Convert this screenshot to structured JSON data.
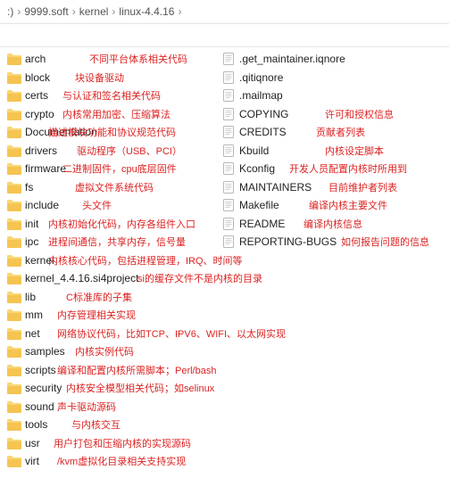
{
  "breadcrumb": {
    "root": ":)",
    "p1": "9999.soft",
    "p2": "kernel",
    "p3": "linux-4.4.16",
    "sep": "›"
  },
  "left": [
    {
      "name": "arch",
      "type": "folder",
      "note": "不同平台体系相关代码",
      "nx": 86
    },
    {
      "name": "block",
      "type": "folder",
      "note": "块设备驱动",
      "nx": 70
    },
    {
      "name": "certs",
      "type": "folder",
      "note": "与认证和签名相关代码",
      "nx": 56
    },
    {
      "name": "crypto",
      "type": "folder",
      "note": "内核常用加密、压缩算法",
      "nx": 56
    },
    {
      "name": "Documentation",
      "type": "folder",
      "note": "描述模块功能和协议规范代码",
      "nx": 40
    },
    {
      "name": "drivers",
      "type": "folder",
      "note": "驱动程序（USB、PCI）",
      "nx": 72
    },
    {
      "name": "firmware",
      "type": "folder",
      "note": "二进制固件，cpu底层固件",
      "nx": 56
    },
    {
      "name": "fs",
      "type": "folder",
      "note": "虚拟文件系统代码",
      "nx": 70
    },
    {
      "name": "include",
      "type": "folder",
      "note": "头文件",
      "nx": 78
    },
    {
      "name": "init",
      "type": "folder",
      "note": "内核初始化代码，内存各组件入口",
      "nx": 40
    },
    {
      "name": "ipc",
      "type": "folder",
      "note": "进程间通信，共享内存，信号量",
      "nx": 40
    },
    {
      "name": "kernel",
      "type": "folder",
      "note": "内核核心代码，包括进程管理，IRQ、时间等",
      "nx": 40
    },
    {
      "name": "kernel_4.4.16.si4project",
      "type": "folder",
      "note": "si的缓存文件不是内核的目录",
      "nx": 140
    },
    {
      "name": "lib",
      "type": "folder",
      "note": "C标准库的子集",
      "nx": 60
    },
    {
      "name": "mm",
      "type": "folder",
      "note": "内存管理相关实现",
      "nx": 50
    },
    {
      "name": "net",
      "type": "folder",
      "note": "网络协议代码，比如TCP、IPV6、WIFI、以太网实现",
      "nx": 50
    },
    {
      "name": "samples",
      "type": "folder",
      "note": "内核实例代码",
      "nx": 70
    },
    {
      "name": "scripts",
      "type": "folder",
      "note": "编译和配置内核所需脚本；Perl/bash",
      "nx": 50
    },
    {
      "name": "security",
      "type": "folder",
      "note": "内核安全模型相关代码；如selinux",
      "nx": 60
    },
    {
      "name": "sound",
      "type": "folder",
      "note": "声卡驱动源码",
      "nx": 50
    },
    {
      "name": "tools",
      "type": "folder",
      "note": "与内核交互",
      "nx": 66
    },
    {
      "name": "usr",
      "type": "folder",
      "note": "用户打包和压缩内核的实现源码",
      "nx": 46
    },
    {
      "name": "virt",
      "type": "folder",
      "note": "/kvm虚拟化目录相关支持实现",
      "nx": 50
    }
  ],
  "right": [
    {
      "name": ".get_maintainer.iqnore",
      "type": "file"
    },
    {
      "name": ".qitiqnore",
      "type": "file"
    },
    {
      "name": ".mailmap",
      "type": "file"
    },
    {
      "name": "COPYING",
      "type": "file",
      "note": "许可和授权信息",
      "nx": 110
    },
    {
      "name": "CREDITS",
      "type": "file",
      "note": "贡献者列表",
      "nx": 100
    },
    {
      "name": "Kbuild",
      "type": "file",
      "note": "内核设定脚本",
      "nx": 110
    },
    {
      "name": "Kconfig",
      "type": "file",
      "note": "开发人员配置内核时所用到",
      "nx": 70
    },
    {
      "name": "MAINTAINERS",
      "type": "file",
      "note": "目前维护者列表",
      "nx": 114
    },
    {
      "name": "Makefile",
      "type": "file",
      "note": "编译内核主要文件",
      "nx": 92
    },
    {
      "name": "README",
      "type": "file",
      "note": "编译内核信息",
      "nx": 86
    },
    {
      "name": "REPORTING-BUGS",
      "type": "file",
      "note": "如何报告问题的信息",
      "nx": 128
    }
  ]
}
